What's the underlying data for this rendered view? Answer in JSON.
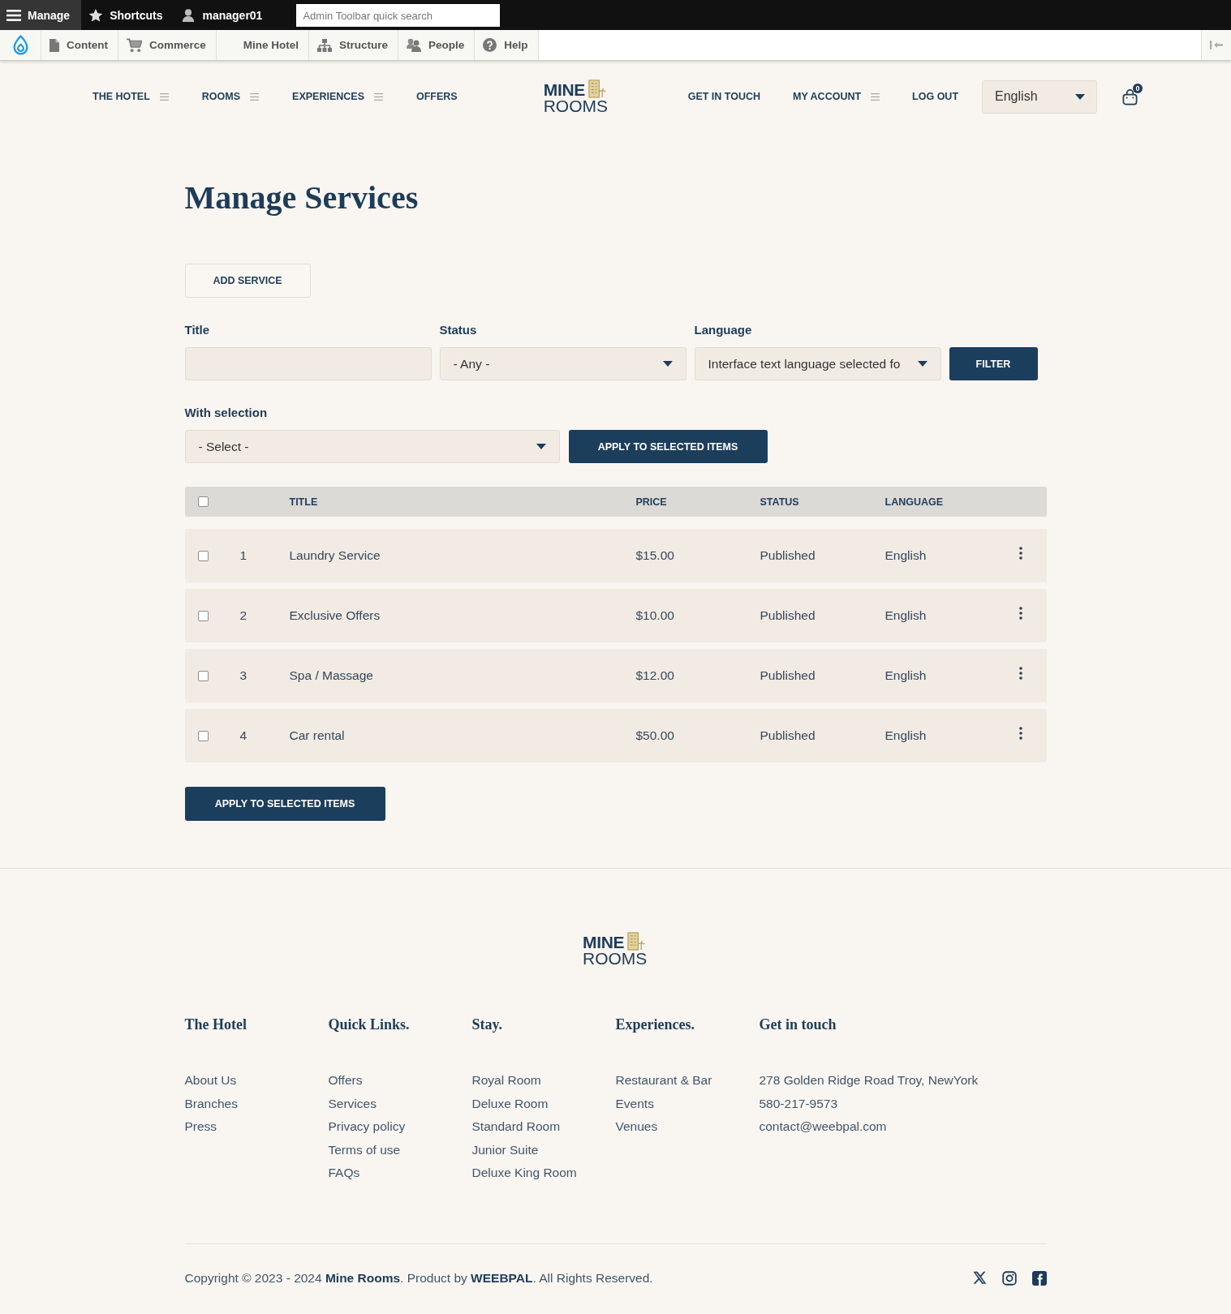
{
  "admin_toolbar": {
    "items": [
      {
        "label": "Manage",
        "selected": true
      },
      {
        "label": "Shortcuts",
        "selected": false
      },
      {
        "label": "manager01",
        "selected": false
      }
    ],
    "search": {
      "placeholder": "Admin Toolbar quick search"
    }
  },
  "admin_menu": {
    "items": [
      {
        "label": "Content"
      },
      {
        "label": "Commerce"
      },
      {
        "label": "Mine Hotel"
      },
      {
        "label": "Structure"
      },
      {
        "label": "People"
      },
      {
        "label": "Help"
      }
    ]
  },
  "site_nav": {
    "left": [
      {
        "label": "THE HOTEL",
        "has_menu": true
      },
      {
        "label": "ROOMS",
        "has_menu": true
      },
      {
        "label": "EXPERIENCES",
        "has_menu": true
      },
      {
        "label": "OFFERS",
        "has_menu": false
      }
    ],
    "logo": {
      "top": "MINE",
      "bottom": "ROOMS"
    },
    "right": [
      {
        "label": "GET IN TOUCH",
        "has_menu": false
      },
      {
        "label": "MY ACCOUNT",
        "has_menu": true
      },
      {
        "label": "LOG OUT",
        "has_menu": false
      }
    ],
    "language_select": {
      "value": "English"
    },
    "cart": {
      "count": "0"
    }
  },
  "page": {
    "title": "Manage Services",
    "add_button": "ADD SERVICE",
    "filters": [
      {
        "label": "Title",
        "kind": "text"
      },
      {
        "label": "Status",
        "kind": "select",
        "value": "- Any -"
      },
      {
        "label": "Language",
        "kind": "select",
        "value": "Interface text language selected fo"
      }
    ],
    "filter_button": "FILTER",
    "bulk": {
      "label": "With selection",
      "value": "- Select -",
      "button": "APPLY TO SELECTED ITEMS"
    }
  },
  "table": {
    "select_all": {
      "checked": false
    },
    "columns": [
      "TITLE",
      "PRICE",
      "STATUS",
      "LANGUAGE"
    ],
    "rows": [
      {
        "checked": false,
        "number": "1",
        "title": "Laundry Service",
        "price": "$15.00",
        "status": "Published",
        "language": "English"
      },
      {
        "checked": false,
        "number": "2",
        "title": "Exclusive Offers",
        "price": "$10.00",
        "status": "Published",
        "language": "English"
      },
      {
        "checked": false,
        "number": "3",
        "title": "Spa / Massage",
        "price": "$12.00",
        "status": "Published",
        "language": "English"
      },
      {
        "checked": false,
        "number": "4",
        "title": "Car rental",
        "price": "$50.00",
        "status": "Published",
        "language": "English"
      }
    ]
  },
  "bottom_button": "APPLY TO SELECTED ITEMS",
  "footer": {
    "logo": {
      "top": "MINE",
      "bottom": "ROOMS"
    },
    "columns": [
      {
        "heading": "The Hotel",
        "links": [
          "About Us",
          "Branches",
          "Press"
        ]
      },
      {
        "heading": "Quick Links.",
        "links": [
          "Offers",
          "Services",
          "Privacy policy",
          "Terms of use",
          "FAQs"
        ]
      },
      {
        "heading": "Stay.",
        "links": [
          "Royal Room",
          "Deluxe Room",
          "Standard Room",
          "Junior Suite",
          "Deluxe King Room"
        ]
      },
      {
        "heading": "Experiences.",
        "links": [
          "Restaurant & Bar",
          "Events",
          "Venues"
        ]
      },
      {
        "heading": "Get in touch",
        "lines": [
          "278 Golden Ridge Road Troy, NewYork",
          "580-217-9573",
          "contact@weebpal.com"
        ]
      }
    ],
    "copyright": "Copyright © 2023 - 2024 **Mine Rooms**. Product by **WEEBPAL**. All Rights Reserved."
  }
}
